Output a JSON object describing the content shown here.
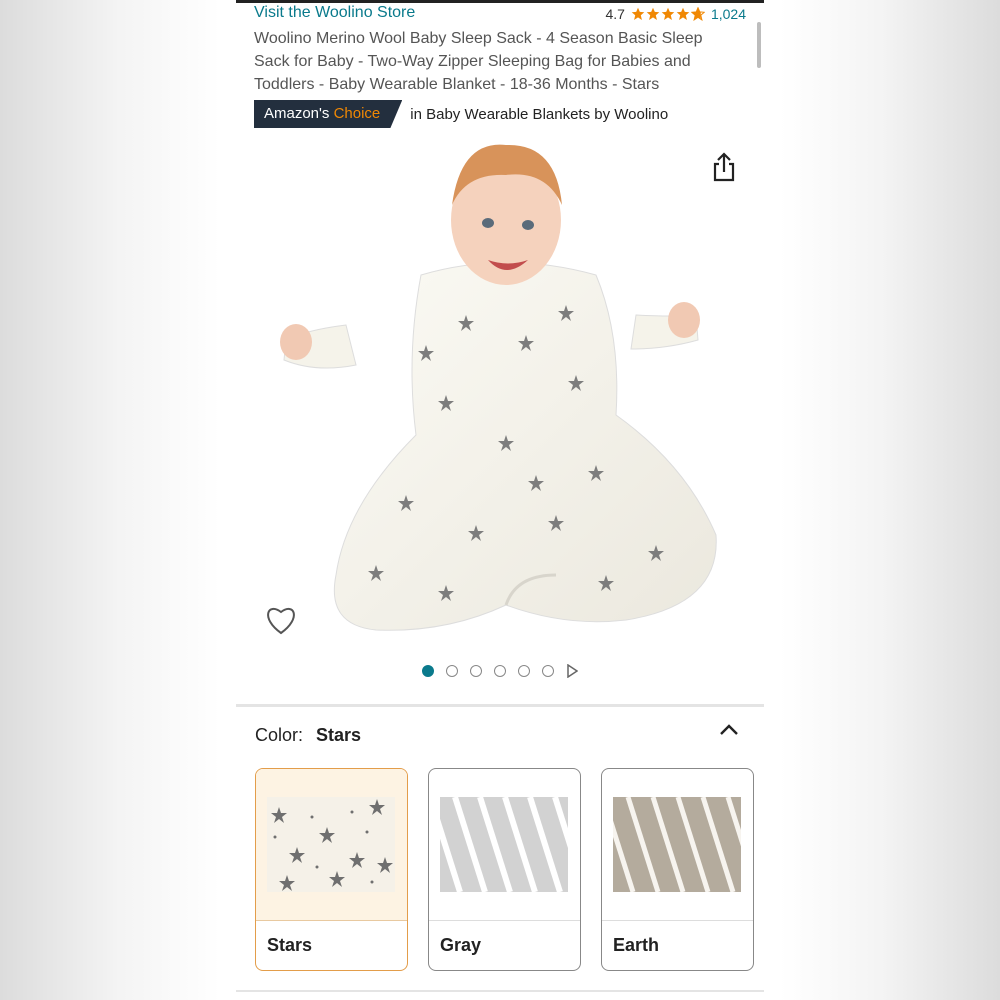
{
  "store": {
    "link_text": "Visit the Woolino Store"
  },
  "rating": {
    "score": "4.7",
    "count": "1,024",
    "stars": 4.7,
    "star_color": "#f08804"
  },
  "product": {
    "title": "Woolino Merino Wool Baby Sleep Sack - 4 Season Basic Sleep Sack for Baby - Two-Way Zipper Sleeping Bag for Babies and Toddlers - Baby Wearable Blanket - 18-36 Months - Stars"
  },
  "badge": {
    "prefix": "Amazon's",
    "accent": "Choice",
    "category": "in Baby Wearable Blankets by Woolino",
    "bg_color": "#232f3e",
    "accent_color": "#f08804"
  },
  "carousel": {
    "image_count": 6,
    "active_index": 0,
    "accent_color": "#0a7a8c"
  },
  "color_selector": {
    "label": "Color:",
    "selected": "Stars",
    "options": [
      {
        "name": "Stars",
        "selected": true
      },
      {
        "name": "Gray",
        "selected": false
      },
      {
        "name": "Earth",
        "selected": false
      }
    ]
  },
  "icons": {
    "share": "share-icon",
    "favorite": "heart-icon",
    "collapse": "chevron-up-icon",
    "carousel_next": "play-triangle-icon"
  }
}
